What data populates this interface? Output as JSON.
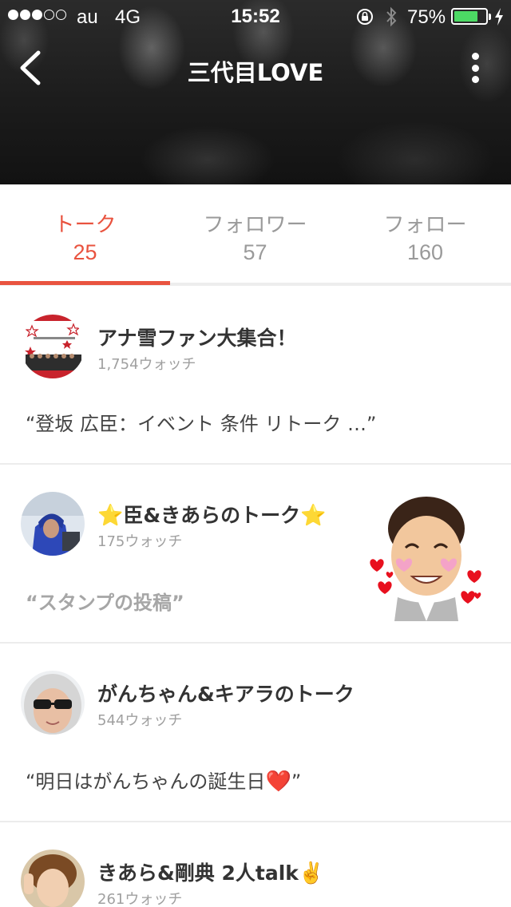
{
  "status_bar": {
    "carrier": "au",
    "network": "4G",
    "time": "15:52",
    "battery_percent": "75%",
    "battery_level": 0.75,
    "signal_bars": 3,
    "signal_total": 5
  },
  "nav": {
    "title": "三代目LOVE",
    "back_icon": "chevron-left-icon",
    "more_icon": "vertical-ellipsis-icon"
  },
  "tabs": [
    {
      "label": "トーク",
      "count": "25",
      "active": true
    },
    {
      "label": "フォロワー",
      "count": "57",
      "active": false
    },
    {
      "label": "フォロー",
      "count": "160",
      "active": false
    }
  ],
  "talks": [
    {
      "title": "アナ雪ファン大集合！",
      "watch": "1,754ウォッチ",
      "quote": "“登坂 広臣：イベント 条件 リトーク …”"
    },
    {
      "title": "臣&きあらのトーク",
      "title_prefix_emoji": "⭐",
      "title_suffix_emoji": "⭐",
      "watch": "175ウォッチ",
      "quote": "“スタンプの投稿”"
    },
    {
      "title": "がんちゃん&キアラのトーク",
      "watch": "544ウォッチ",
      "quote": "“明日はがんちゃんの誕生日",
      "quote_emoji": "❤️",
      "quote_end": "”"
    },
    {
      "title": "きあら&剛典 2人talk",
      "title_suffix_emoji": "✌️",
      "watch": "261ウォッチ"
    }
  ],
  "colors": {
    "accent": "#e9533f",
    "inactive_tab": "#9a9a9a",
    "battery": "#4cd964"
  }
}
